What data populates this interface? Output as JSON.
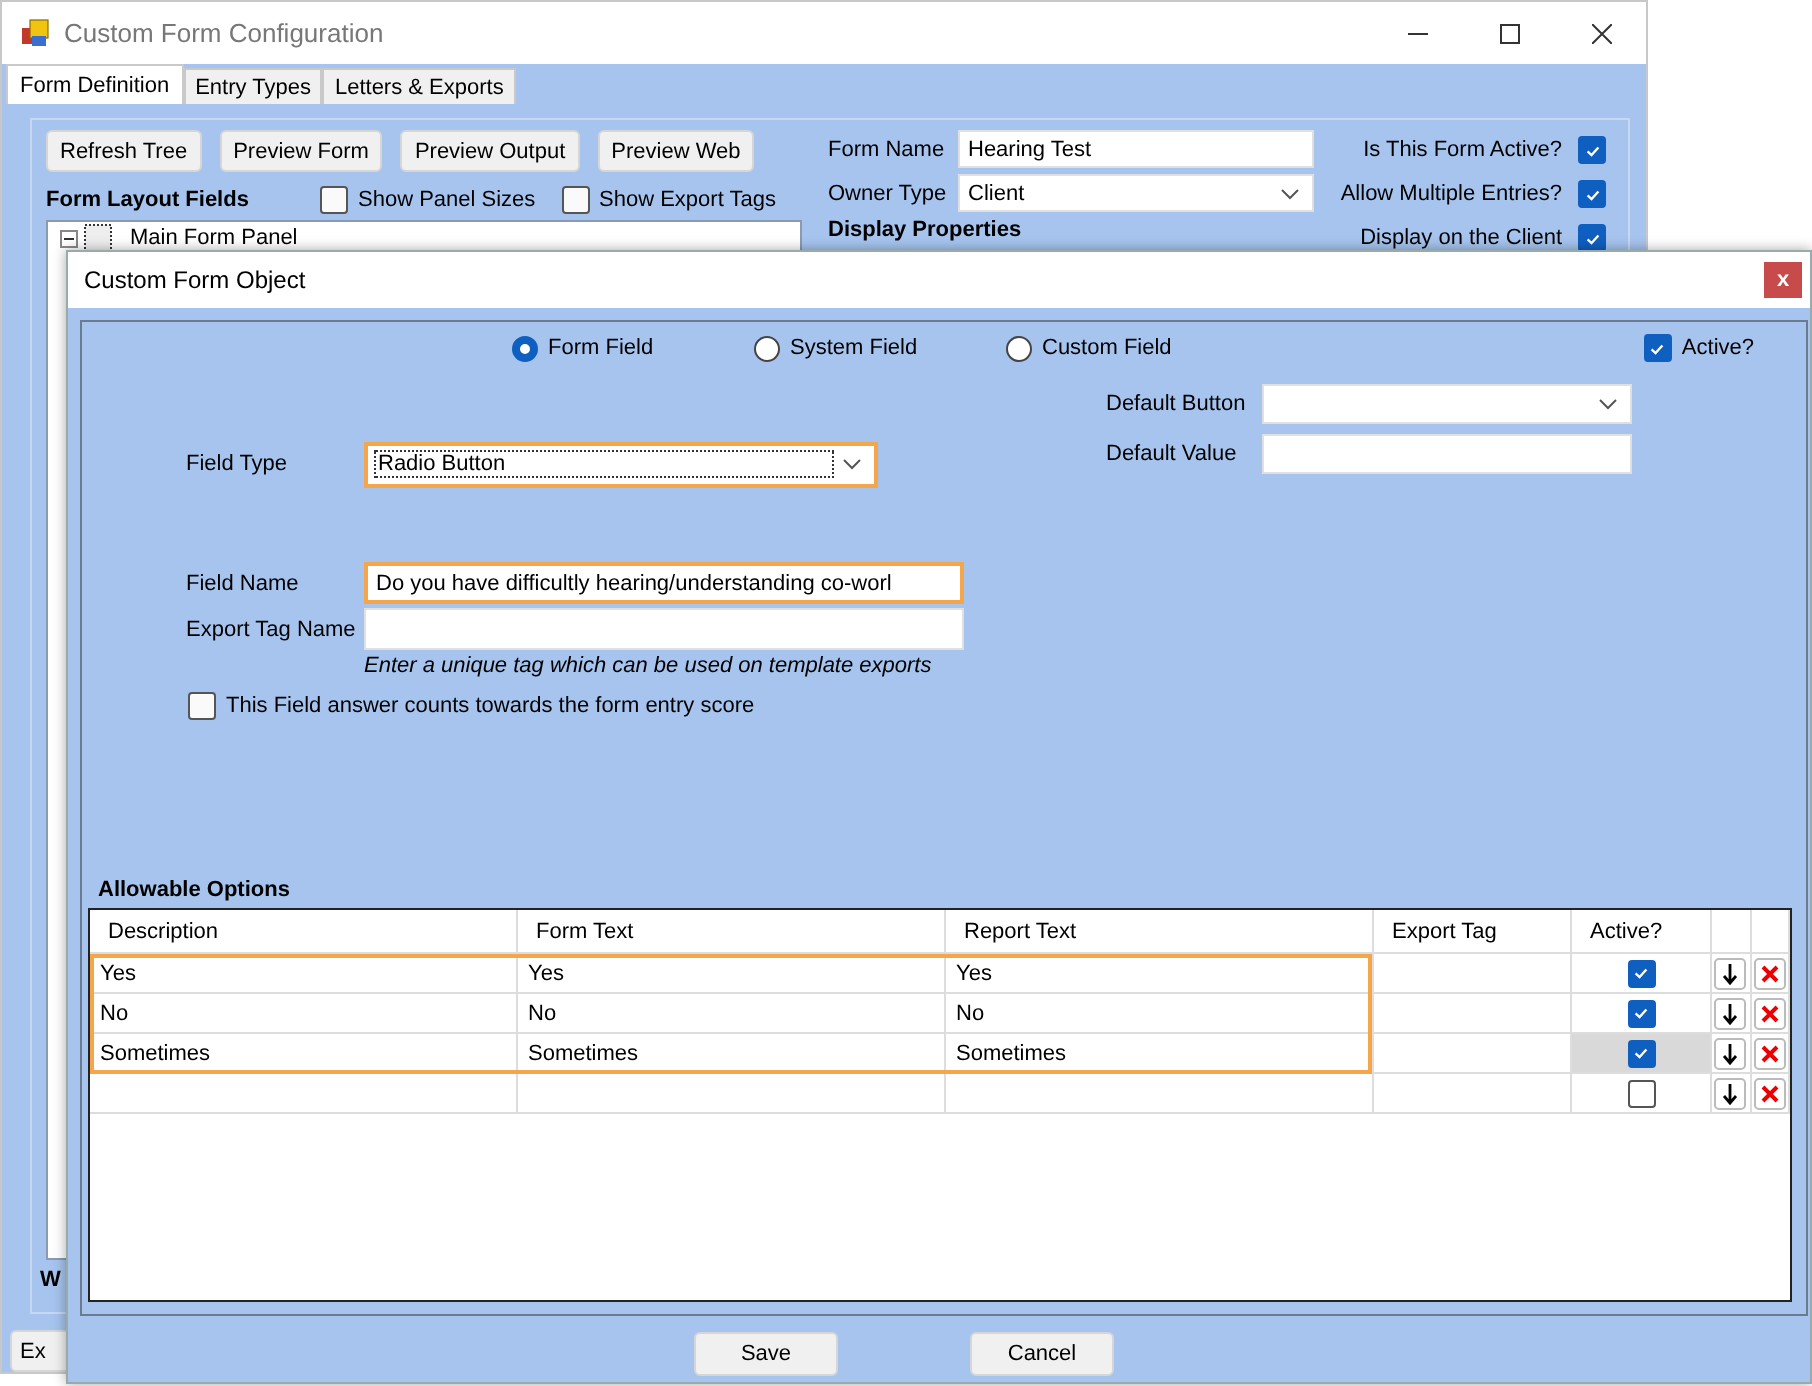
{
  "main_window": {
    "title": "Custom Form Configuration",
    "tabs": [
      {
        "label": "Form Definition",
        "selected": true
      },
      {
        "label": "Entry Types",
        "selected": false
      },
      {
        "label": "Letters & Exports",
        "selected": false
      }
    ],
    "toolbar_buttons": [
      "Refresh Tree",
      "Preview Form",
      "Preview Output",
      "Preview Web"
    ],
    "layout_fields": {
      "label": "Form Layout Fields",
      "options": [
        {
          "label": "Show Panel Sizes",
          "checked": false
        },
        {
          "label": "Show Export Tags",
          "checked": false
        }
      ],
      "tree": [
        {
          "label": "Main Form Panel",
          "expanded": true
        }
      ]
    },
    "form_name": {
      "label": "Form Name",
      "value": "Hearing Test"
    },
    "owner_type": {
      "label": "Owner Type",
      "value": "Client"
    },
    "flags": [
      {
        "label": "Is This Form Active?",
        "checked": true
      },
      {
        "label": "Allow Multiple Entries?",
        "checked": true
      },
      {
        "label": "Display on the Client",
        "checked": true
      }
    ],
    "display_properties_heading": "Display Properties",
    "bottom_heading": "W",
    "bottom_button": "Ex"
  },
  "dialog": {
    "title": "Custom Form Object",
    "close": "x",
    "source": [
      {
        "label": "Form Field",
        "selected": true
      },
      {
        "label": "System Field",
        "selected": false
      },
      {
        "label": "Custom Field",
        "selected": false
      }
    ],
    "active": {
      "label": "Active?",
      "checked": true
    },
    "field_type": {
      "label": "Field Type",
      "value": "Radio Button",
      "highlighted": true
    },
    "default_button": {
      "label": "Default Button"
    },
    "default_value": {
      "label": "Default Value"
    },
    "field_name": {
      "label": "Field Name",
      "value": "Do you have difficultly hearing/understanding co-worl",
      "highlighted": true
    },
    "export_tag": {
      "label": "Export Tag Name",
      "hint": "Enter a unique tag which can be used on template exports"
    },
    "score_option": {
      "label": "This Field answer counts towards the form entry score",
      "checked": false
    },
    "options": {
      "title": "Allowable Options",
      "columns": [
        "Description",
        "Form Text",
        "Report Text",
        "Export Tag",
        "Active?"
      ],
      "rows": [
        {
          "description": "Yes",
          "form_text": "Yes",
          "report_text": "Yes",
          "active": true,
          "active_cell_selected": false,
          "highlighted": true
        },
        {
          "description": "No",
          "form_text": "No",
          "report_text": "No",
          "active": true,
          "active_cell_selected": false,
          "highlighted": true
        },
        {
          "description": "Sometimes",
          "form_text": "Sometimes",
          "report_text": "Sometimes",
          "active": true,
          "active_cell_selected": true,
          "highlighted": true
        },
        {
          "active": false,
          "active_cell_selected": false,
          "highlighted": false
        }
      ]
    },
    "buttons": [
      "Save",
      "Cancel"
    ]
  }
}
